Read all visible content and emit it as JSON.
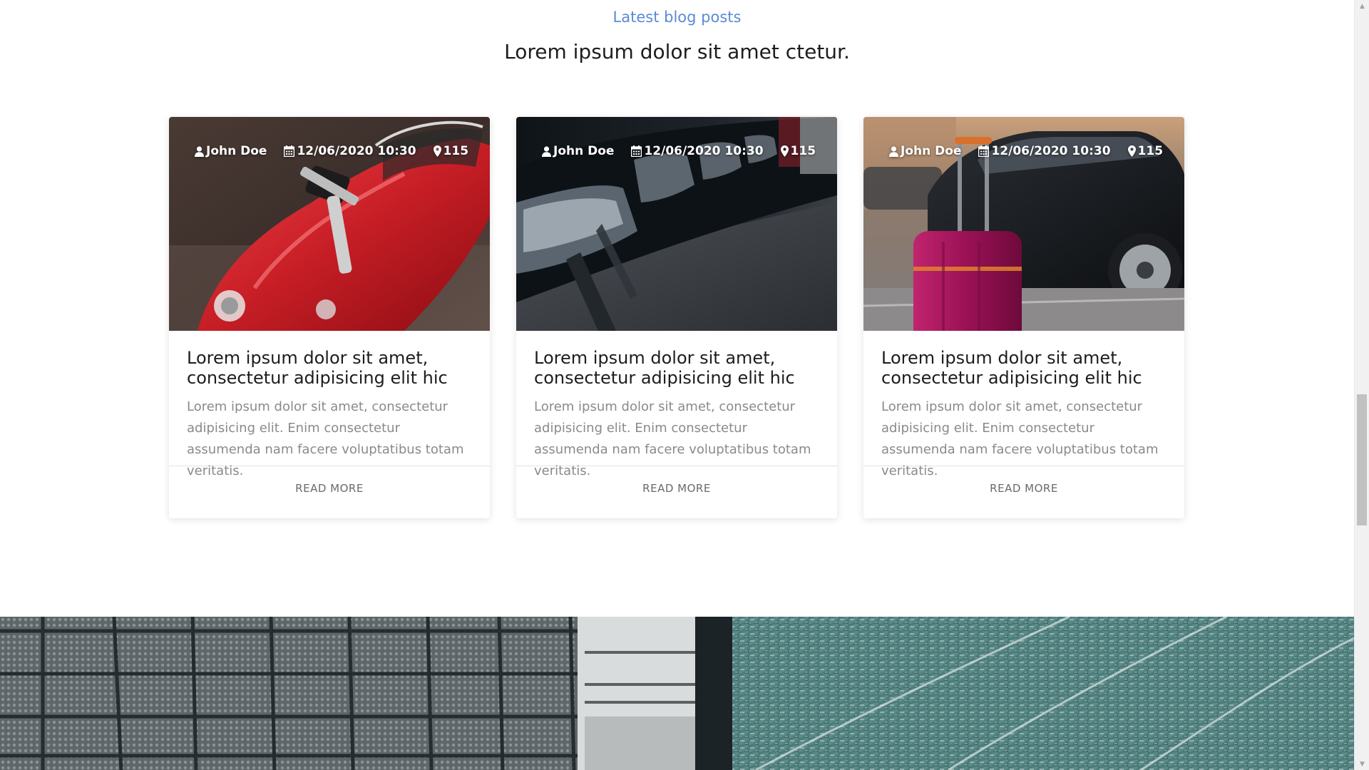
{
  "section": {
    "eyebrow": "Latest blog posts",
    "title": "Lorem ipsum dolor sit amet ctetur."
  },
  "posts": [
    {
      "image": "red-toy-car-with-key-photo",
      "author": "John Doe",
      "datetime": "12/06/2020 10:30",
      "location_count": "115",
      "title": "Lorem ipsum dolor sit amet, consectetur adipisicing elit hic",
      "excerpt": "Lorem ipsum dolor sit amet, consectetur adipisicing elit. Enim consectetur assumenda nam facere voluptatibus totam veritatis.",
      "cta": "READ MORE"
    },
    {
      "image": "row-of-parked-cars-headlights-photo",
      "author": "John Doe",
      "datetime": "12/06/2020 10:30",
      "location_count": "115",
      "title": "Lorem ipsum dolor sit amet, consectetur adipisicing elit hic",
      "excerpt": "Lorem ipsum dolor sit amet, consectetur adipisicing elit. Enim consectetur assumenda nam facere voluptatibus totam veritatis.",
      "cta": "READ MORE"
    },
    {
      "image": "pink-suitcase-beside-black-car-photo",
      "author": "John Doe",
      "datetime": "12/06/2020 10:30",
      "location_count": "115",
      "title": "Lorem ipsum dolor sit amet, consectetur adipisicing elit hic",
      "excerpt": "Lorem ipsum dolor sit amet, consectetur adipisicing elit. Enim consectetur assumenda nam facere voluptatibus totam veritatis.",
      "cta": "READ MORE"
    }
  ],
  "icons": {
    "author": "user-icon",
    "date": "calendar-icon",
    "location": "map-marker-icon"
  },
  "colors": {
    "accent": "#5b8ad6",
    "heading": "#1d1d1d",
    "body_text": "#8a8a8a",
    "footer_text": "#6a6a6a"
  }
}
